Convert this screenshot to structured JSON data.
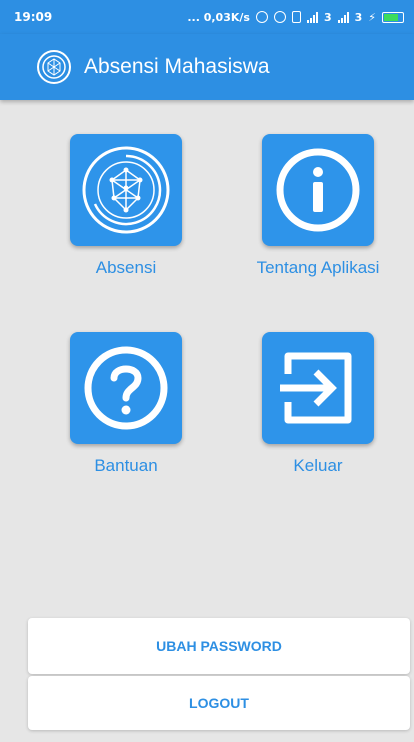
{
  "status_bar": {
    "time": "19:09",
    "net_speed": "... 0,03K/s",
    "sim1": "3",
    "sim2": "3"
  },
  "app_bar": {
    "title": "Absensi Mahasiswa",
    "logo_icon": "face-scan-icon"
  },
  "menu": [
    {
      "label": "Absensi",
      "icon": "face-scan-icon"
    },
    {
      "label": "Tentang Aplikasi",
      "icon": "info-icon"
    },
    {
      "label": "Bantuan",
      "icon": "help-icon"
    },
    {
      "label": "Keluar",
      "icon": "exit-icon"
    }
  ],
  "actions": {
    "change_password": "UBAH PASSWORD",
    "logout": "LOGOUT"
  },
  "colors": {
    "primary": "#2d8fe3",
    "tile": "#2e94ea",
    "background": "#e6e6e6"
  }
}
